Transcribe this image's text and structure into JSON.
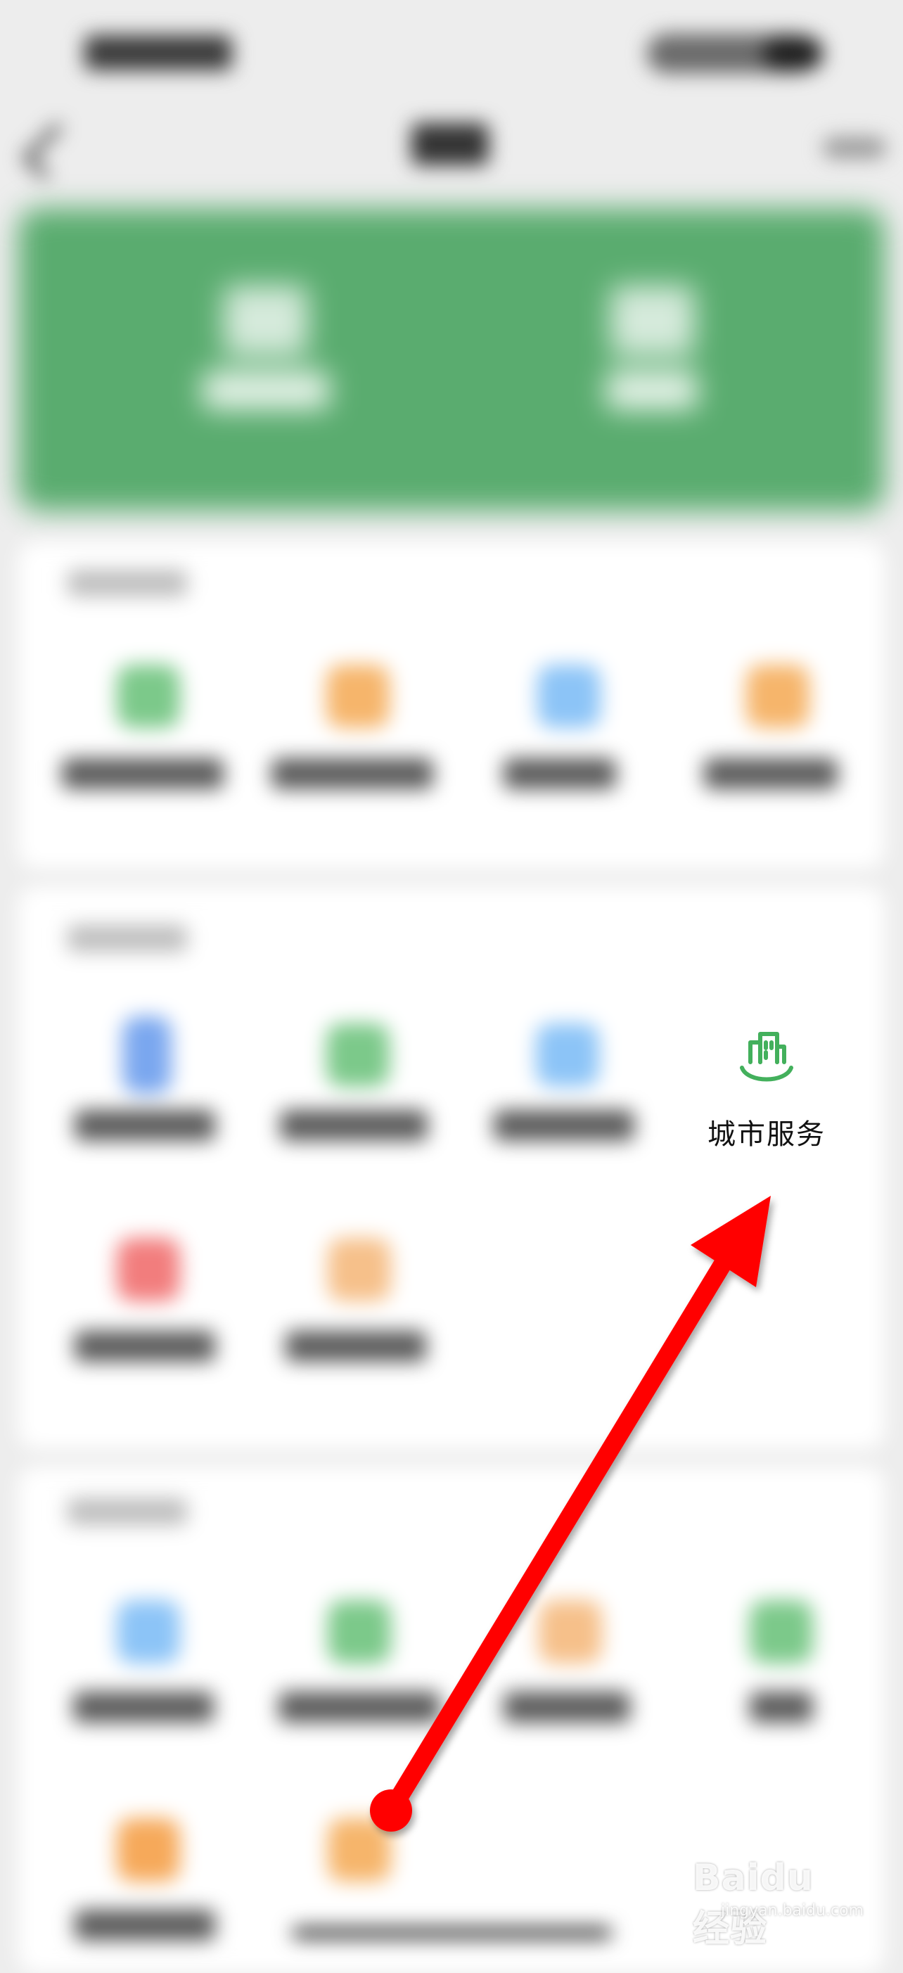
{
  "city_service": {
    "label": "城市服务",
    "accent_color": "#43b05c"
  },
  "annotation": {
    "arrow_color": "#ff0000"
  },
  "watermark": {
    "main": "Baidu 经验",
    "sub": "jingyan.baidu.com"
  },
  "icon_colors": {
    "green": "#7cc98a",
    "orange": "#f6b56b",
    "blue": "#8cc4f7",
    "red": "#f27d7d"
  }
}
